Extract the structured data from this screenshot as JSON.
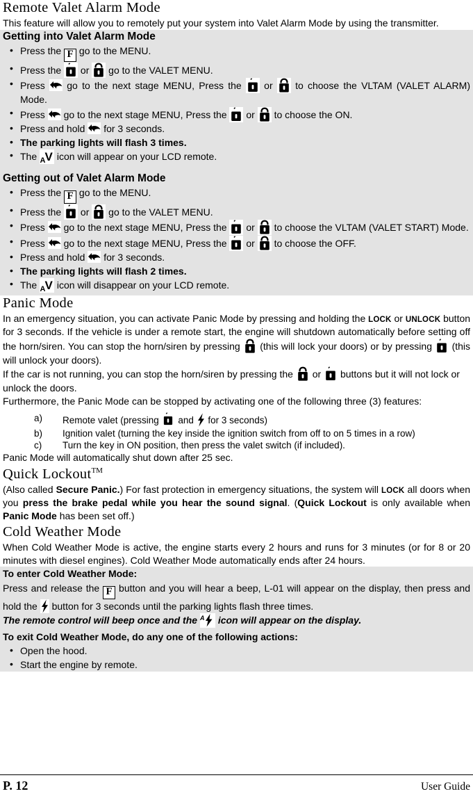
{
  "document": {
    "page_label": "P. 12",
    "guide_label": "User Guide"
  },
  "sections": [
    {
      "id": "remote_valet_alarm_mode",
      "heading": "Remote Valet Alarm Mode",
      "intro": "This feature will allow you to remotely put your system into Valet Alarm Mode by using the transmitter.",
      "sub_in": {
        "heading": "Getting into Valet Alarm Mode",
        "items": [
          {
            "pre": "Press the",
            "post": "go to the MENU.",
            "icons": [
              "f-button-icon"
            ]
          },
          {
            "pre": "Press the",
            "mid": "or",
            "post": "go to the VALET MENU.",
            "icons": [
              "lock-icon",
              "unlock-icon"
            ]
          },
          {
            "pre": "Press",
            "mid": "go to the next stage MENU, Press the",
            "mid2": "or",
            "post": "to choose the VLTAM (VALET ALARM) Mode.",
            "icons": [
              "hand-press-icon",
              "lock-icon",
              "unlock-icon"
            ]
          },
          {
            "pre": "Press",
            "mid": "go to the next stage MENU, Press the",
            "mid2": "or",
            "post": "to choose the ON.",
            "icons": [
              "hand-press-icon",
              "lock-icon",
              "unlock-icon"
            ]
          },
          {
            "pre": "Press and hold",
            "post": "for 3 seconds.",
            "icons": [
              "hand-press-icon"
            ]
          },
          {
            "bold": "The parking lights will flash 3 times."
          },
          {
            "pre": "The",
            "post": "icon will appear on your LCD remote.",
            "icons": [
              "valet-av-icon"
            ]
          }
        ]
      },
      "sub_out": {
        "heading": "Getting out of Valet Alarm Mode",
        "items": [
          {
            "pre": "Press the",
            "post": "go to the MENU.",
            "icons": [
              "f-button-icon"
            ]
          },
          {
            "pre": "Press the",
            "mid": "or",
            "post": "go to the VALET MENU.",
            "icons": [
              "lock-icon",
              "unlock-icon"
            ]
          },
          {
            "pre": "Press",
            "mid": "go to the next stage MENU, Press the",
            "mid2": "or",
            "post": "to choose the VLTAM (VALET START) Mode.",
            "icons": [
              "hand-press-icon",
              "lock-icon",
              "unlock-icon"
            ]
          },
          {
            "pre": "Press",
            "mid": "go to the next stage MENU, Press the",
            "mid2": "or",
            "post": "to choose the OFF.",
            "icons": [
              "hand-press-icon",
              "lock-icon",
              "unlock-icon"
            ]
          },
          {
            "pre": "Press and hold",
            "post": "for 3 seconds.",
            "icons": [
              "hand-press-icon"
            ]
          },
          {
            "bold": "The parking lights will flash 2 times."
          },
          {
            "pre": "The",
            "post": "icon will disappear on your LCD remote.",
            "icons": [
              "valet-av-icon"
            ]
          }
        ]
      }
    },
    {
      "id": "panic_mode",
      "heading": "Panic Mode",
      "para_1a": "In an emergency situation, you can activate Panic Mode by pressing and holding the",
      "lock_word": "LOCK",
      "para_1b": "or",
      "unlock_word": "UNLOCK",
      "para_1c": "button for 3 seconds. If the vehicle is under a remote start, the engine will shutdown automatically before setting off the horn/siren. You can stop the horn/siren by pressing",
      "para_1d": "(this will lock your doors) or by pressing",
      "para_1e": "(this will unlock your doors).",
      "para_2a": "If the car is not running, you can stop the horn/siren by pressing the",
      "para_2b": "or",
      "para_2c": "buttons but it will not lock or unlock the doors.",
      "para_3": "Furthermore, the Panic Mode can be stopped by activating one of the following three (3) features:",
      "list": [
        {
          "marker": "a)",
          "pre": "Remote valet (pressing",
          "mid": "and",
          "post": "for 3 seconds)"
        },
        {
          "marker": "b)",
          "text": "Ignition valet (turning the key inside the ignition switch from off to on 5 times in a row)"
        },
        {
          "marker": "c)",
          "text": "Turn the key in ON position, then press the valet switch (if included)."
        }
      ],
      "para_4": "Panic Mode will automatically shut down after 25 sec."
    },
    {
      "id": "quick_lockout",
      "heading": "Quick Lockout",
      "heading_sup": "TM",
      "p_a": "(Also called",
      "p_b": "Secure Panic.",
      "p_c": ") For fast protection in emergency situations, the system will",
      "p_lock": "LOCK",
      "p_d": "all doors when you",
      "p_e": "press the brake pedal while you hear the sound signal",
      "p_f": ". (",
      "p_g": "Quick Lockout",
      "p_h": "is only available when",
      "p_i": "Panic Mode",
      "p_j": "has been set off.)"
    },
    {
      "id": "cold_weather_mode",
      "heading": "Cold Weather Mode",
      "intro": "When Cold Weather Mode is active, the engine starts every 2 hours and runs for 3 minutes (or for 8 or 20 minutes with diesel engines). Cold Weather Mode automatically ends after 24 hours.",
      "enter_heading": "To enter Cold Weather Mode:",
      "enter_a": "Press and release the",
      "enter_b": "button and you will hear a beep, L-01 will appear on the display, then press and hold the",
      "enter_c": "button for 3 seconds until the parking lights flash three times.",
      "note_a": "The remote control will beep once and the",
      "note_b": "icon will appear on the display.",
      "exit_heading": "To exit Cold Weather Mode, do any one of the following actions:",
      "exit_items": [
        "Open the hood.",
        "Start the engine by remote."
      ]
    }
  ]
}
